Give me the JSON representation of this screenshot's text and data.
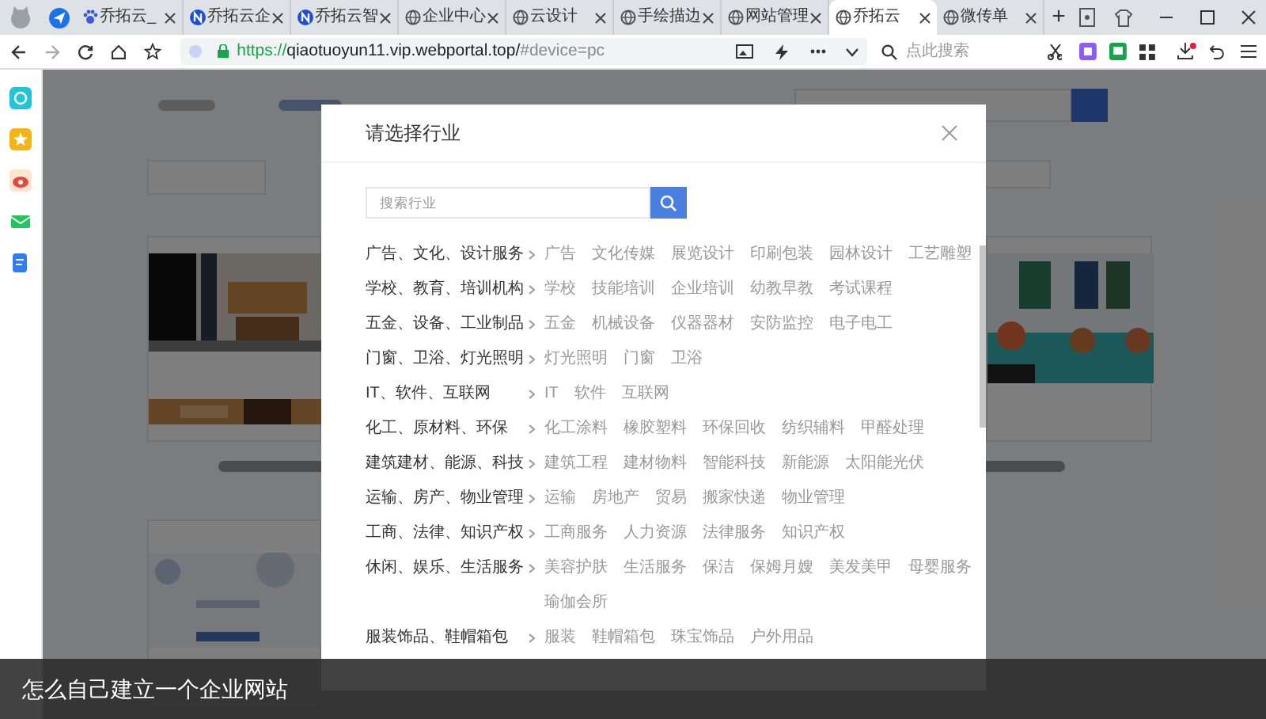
{
  "browser": {
    "tabs": [
      {
        "label": "乔拓云_",
        "kind": "paw",
        "selected": false
      },
      {
        "label": "乔拓云企",
        "kind": "badge",
        "selected": false
      },
      {
        "label": "乔拓云智",
        "kind": "badge",
        "selected": false
      },
      {
        "label": "企业中心",
        "kind": "globe",
        "selected": false
      },
      {
        "label": "云设计",
        "kind": "globe",
        "selected": false
      },
      {
        "label": "手绘描边",
        "kind": "globe",
        "selected": false
      },
      {
        "label": "网站管理",
        "kind": "globe",
        "selected": false
      },
      {
        "label": "乔拓云",
        "kind": "globe",
        "selected": true
      },
      {
        "label": "微传单",
        "kind": "globe",
        "selected": false
      }
    ],
    "new_tab": "+",
    "address": {
      "scheme": "https://",
      "host": "qiaotuoyun11.vip.webportal.top/",
      "fragment": "#device=pc"
    },
    "search": {
      "placeholder": "点此搜索"
    }
  },
  "modal": {
    "title": "请选择行业",
    "search": {
      "placeholder": "搜索行业"
    },
    "categories": [
      {
        "label": "广告、文化、设计服务",
        "items": [
          "广告",
          "文化传媒",
          "展览设计",
          "印刷包装",
          "园林设计",
          "工艺雕塑"
        ]
      },
      {
        "label": "学校、教育、培训机构",
        "items": [
          "学校",
          "技能培训",
          "企业培训",
          "幼教早教",
          "考试课程"
        ]
      },
      {
        "label": "五金、设备、工业制品",
        "items": [
          "五金",
          "机械设备",
          "仪器器材",
          "安防监控",
          "电子电工"
        ]
      },
      {
        "label": "门窗、卫浴、灯光照明",
        "items": [
          "灯光照明",
          "门窗",
          "卫浴"
        ]
      },
      {
        "label": "IT、软件、互联网",
        "items": [
          "IT",
          "软件",
          "互联网"
        ]
      },
      {
        "label": "化工、原材料、环保",
        "items": [
          "化工涂料",
          "橡胶塑料",
          "环保回收",
          "纺织辅料",
          "甲醛处理"
        ]
      },
      {
        "label": "建筑建材、能源、科技",
        "items": [
          "建筑工程",
          "建材物料",
          "智能科技",
          "新能源",
          "太阳能光伏"
        ]
      },
      {
        "label": "运输、房产、物业管理",
        "items": [
          "运输",
          "房地产",
          "贸易",
          "搬家快递",
          "物业管理"
        ]
      },
      {
        "label": "工商、法律、知识产权",
        "items": [
          "工商服务",
          "人力资源",
          "法律服务",
          "知识产权"
        ]
      },
      {
        "label": "休闲、娱乐、生活服务",
        "items": [
          "美容护肤",
          "生活服务",
          "保洁",
          "保姆月嫂",
          "美发美甲",
          "母婴服务",
          "瑜伽会所"
        ]
      },
      {
        "label": "服装饰品、鞋帽箱包",
        "items": [
          "服装",
          "鞋帽箱包",
          "珠宝饰品",
          "户外用品"
        ]
      }
    ]
  },
  "caption": "怎么自己建立一个企业网站"
}
